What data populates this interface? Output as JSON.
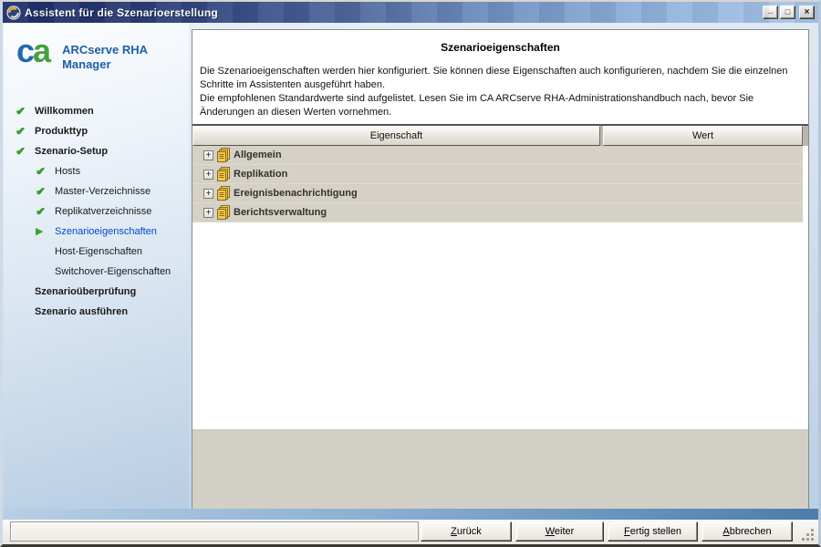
{
  "window": {
    "title": "Assistent für die Szenarioerstellung"
  },
  "icons": {
    "check": "✔",
    "current_arrow": "▶",
    "expand_plus": "+",
    "minimize": "_",
    "maximize": "□",
    "close": "×"
  },
  "sidebar": {
    "logo": "ca",
    "brand_line1": "ARCserve RHA",
    "brand_line2": "Manager",
    "steps": [
      {
        "label": "Willkommen",
        "state": "done",
        "level": 0
      },
      {
        "label": "Produkttyp",
        "state": "done",
        "level": 0
      },
      {
        "label": "Szenario-Setup",
        "state": "done",
        "level": 0
      },
      {
        "label": "Hosts",
        "state": "done",
        "level": 1
      },
      {
        "label": "Master-Verzeichnisse",
        "state": "done",
        "level": 1
      },
      {
        "label": "Replikatverzeichnisse",
        "state": "done",
        "level": 1
      },
      {
        "label": "Szenarioeigenschaften",
        "state": "current",
        "level": 1
      },
      {
        "label": "Host-Eigenschaften",
        "state": "pending",
        "level": 1
      },
      {
        "label": "Switchover-Eigenschaften",
        "state": "pending",
        "level": 1
      },
      {
        "label": "Szenarioüberprüfung",
        "state": "pending",
        "level": 0
      },
      {
        "label": "Szenario ausführen",
        "state": "pending",
        "level": 0
      }
    ]
  },
  "main": {
    "heading": "Szenarioeigenschaften",
    "description_line1": "Die Szenarioeigenschaften werden hier konfiguriert. Sie können diese Eigenschaften auch konfigurieren, nachdem Sie die einzelnen Schritte im Assistenten ausgeführt haben.",
    "description_line2": "Die empfohlenen Standardwerte sind aufgelistet. Lesen Sie im CA ARCserve RHA-Administrationshandbuch nach, bevor Sie Änderungen an diesen Werten vornehmen.",
    "table": {
      "columns": [
        "Eigenschaft",
        "Wert"
      ],
      "groups": [
        {
          "label": "Allgemein"
        },
        {
          "label": "Replikation"
        },
        {
          "label": "Ereignisbenachrichtigung"
        },
        {
          "label": "Berichtsverwaltung"
        }
      ]
    }
  },
  "footer": {
    "buttons": [
      {
        "label": "Zurück",
        "accesskey": "Z"
      },
      {
        "label": "Weiter",
        "accesskey": "W"
      },
      {
        "label": "Fertig stellen",
        "accesskey": "F"
      },
      {
        "label": "Abbrechen",
        "accesskey": "A"
      }
    ]
  },
  "colors": {
    "titlebar_left": "#1d2e6a",
    "titlebar_right": "#a9c8ea",
    "accent_green": "#3aa32f",
    "current_step_blue": "#0047d0",
    "row_bg": "#d5d1c7",
    "brand_blue": "#1d5fa8"
  }
}
